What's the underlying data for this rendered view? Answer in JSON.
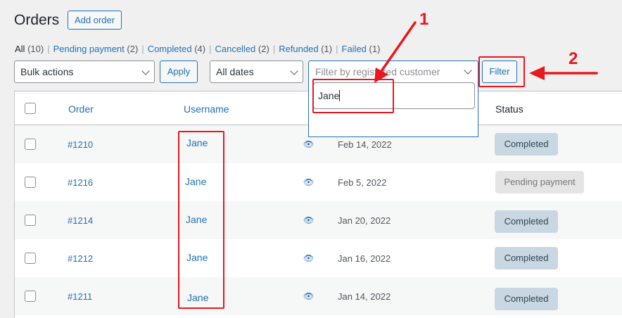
{
  "header": {
    "title": "Orders",
    "add_order_label": "Add order"
  },
  "filters_status": [
    {
      "label": "All",
      "count": "(10)",
      "current": true
    },
    {
      "label": "Pending payment",
      "count": "(2)"
    },
    {
      "label": "Completed",
      "count": "(4)"
    },
    {
      "label": "Cancelled",
      "count": "(2)"
    },
    {
      "label": "Refunded",
      "count": "(1)"
    },
    {
      "label": "Failed",
      "count": "(1)"
    }
  ],
  "toolbar": {
    "bulk_actions": "Bulk actions",
    "apply_label": "Apply",
    "dates": "All dates",
    "customer_placeholder": "Filter by registered customer",
    "customer_search_value": "Jane",
    "filter_label": "Filter"
  },
  "table": {
    "columns": {
      "order": "Order",
      "username": "Username",
      "status": "Status"
    },
    "rows": [
      {
        "order": "#1210",
        "username": "Jane",
        "date": "Feb 14, 2022",
        "status": "Completed",
        "status_type": "completed"
      },
      {
        "order": "#1216",
        "username": "Jane",
        "date": "Feb 5, 2022",
        "status": "Pending payment",
        "status_type": "pending"
      },
      {
        "order": "#1214",
        "username": "Jane",
        "date": "Jan 20, 2022",
        "status": "Completed",
        "status_type": "completed"
      },
      {
        "order": "#1212",
        "username": "Jane",
        "date": "Jan 16, 2022",
        "status": "Completed",
        "status_type": "completed"
      },
      {
        "order": "#1211",
        "username": "Jane",
        "date": "Jan 14, 2022",
        "status": "Completed",
        "status_type": "completed"
      }
    ]
  },
  "annotations": {
    "step1": "1",
    "step2": "2",
    "color": "#e8181f"
  },
  "icons": {
    "preview": "eye-icon",
    "dropdown": "chevron-down-icon"
  }
}
